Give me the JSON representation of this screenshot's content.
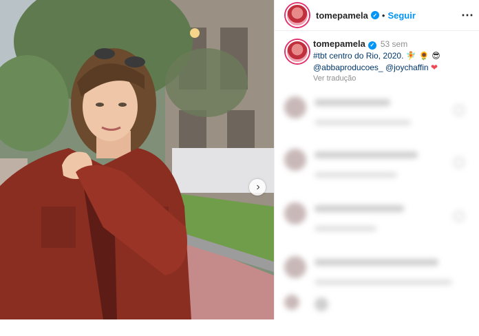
{
  "post": {
    "username": "tomepamela",
    "follow_label": "Seguir",
    "separator": "•",
    "more_icon": "⋯",
    "caption": {
      "username": "tomepamela",
      "time": "53 sem",
      "text_part1": "#tbt centro do Rio, 2020.",
      "emojis": "🧚 🌻 😎",
      "mention1": "@abbaproducoes_",
      "mention2": "@joychaffin",
      "heart": "❤",
      "translate_label": "Ver tradução"
    }
  },
  "colors": {
    "accent": "#0095f6",
    "text": "#262626",
    "muted": "#8e8e8e",
    "jacket": "#8b2e22"
  },
  "icons": {
    "verified": "verified-badge-icon",
    "next": "chevron-right-icon"
  },
  "photo": {
    "description_icon": "post-photo"
  }
}
